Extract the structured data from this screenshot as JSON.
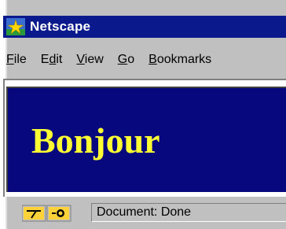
{
  "window": {
    "title": "Netscape"
  },
  "menu": {
    "items": [
      {
        "label": "File",
        "underline": "F",
        "rest": "ile"
      },
      {
        "label": "Edit",
        "pre": "E",
        "underline": "d",
        "rest": "it"
      },
      {
        "label": "View",
        "underline": "V",
        "rest": "iew"
      },
      {
        "label": "Go",
        "underline": "G",
        "rest": "o"
      },
      {
        "label": "Bookmarks",
        "underline": "B",
        "rest": "ookmarks"
      }
    ]
  },
  "page": {
    "heading": "Bonjour",
    "background_color": "#08087e",
    "heading_color": "#ffff33"
  },
  "status": {
    "text": "Document: Done",
    "icons": [
      "security-key-icon",
      "connection-icon"
    ]
  },
  "colors": {
    "title_bar": "#0a1a8c",
    "chrome": "#c0c0c0"
  }
}
